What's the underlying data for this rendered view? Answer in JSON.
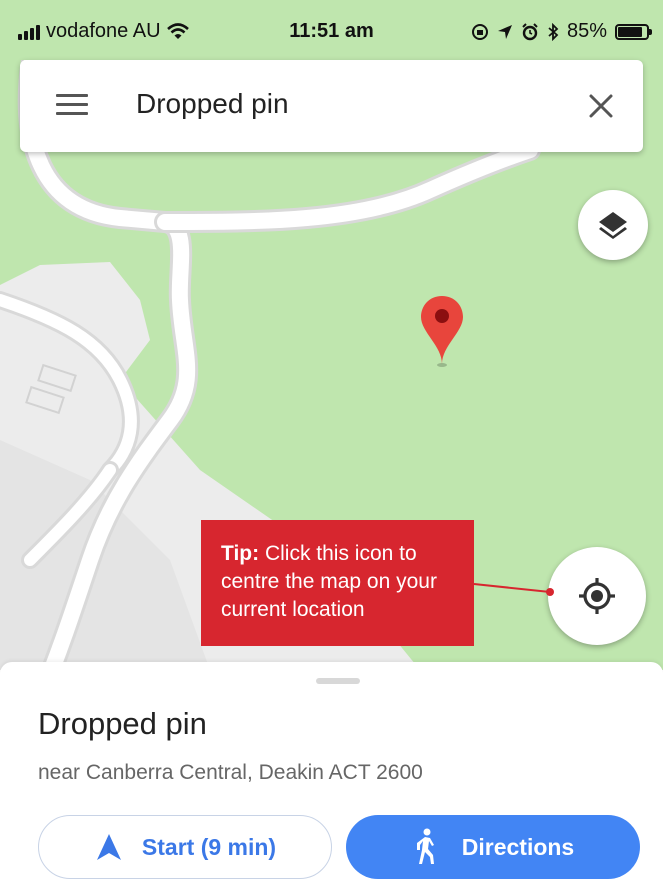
{
  "status_bar": {
    "carrier": "vodafone AU",
    "time": "11:51 am",
    "battery": "85%"
  },
  "search": {
    "query": "Dropped pin"
  },
  "tip": {
    "label": "Tip:",
    "text": "Click this icon to centre the map on your current location"
  },
  "place": {
    "title": "Dropped pin",
    "address": "near Canberra Central, Deakin ACT 2600"
  },
  "actions": {
    "start_label": "Start (9 min)",
    "directions_label": "Directions"
  },
  "colors": {
    "map_green": "#bfe6ae",
    "pin_red": "#e8453c",
    "tip_red": "#d7262f",
    "accent_blue": "#4285f4"
  }
}
